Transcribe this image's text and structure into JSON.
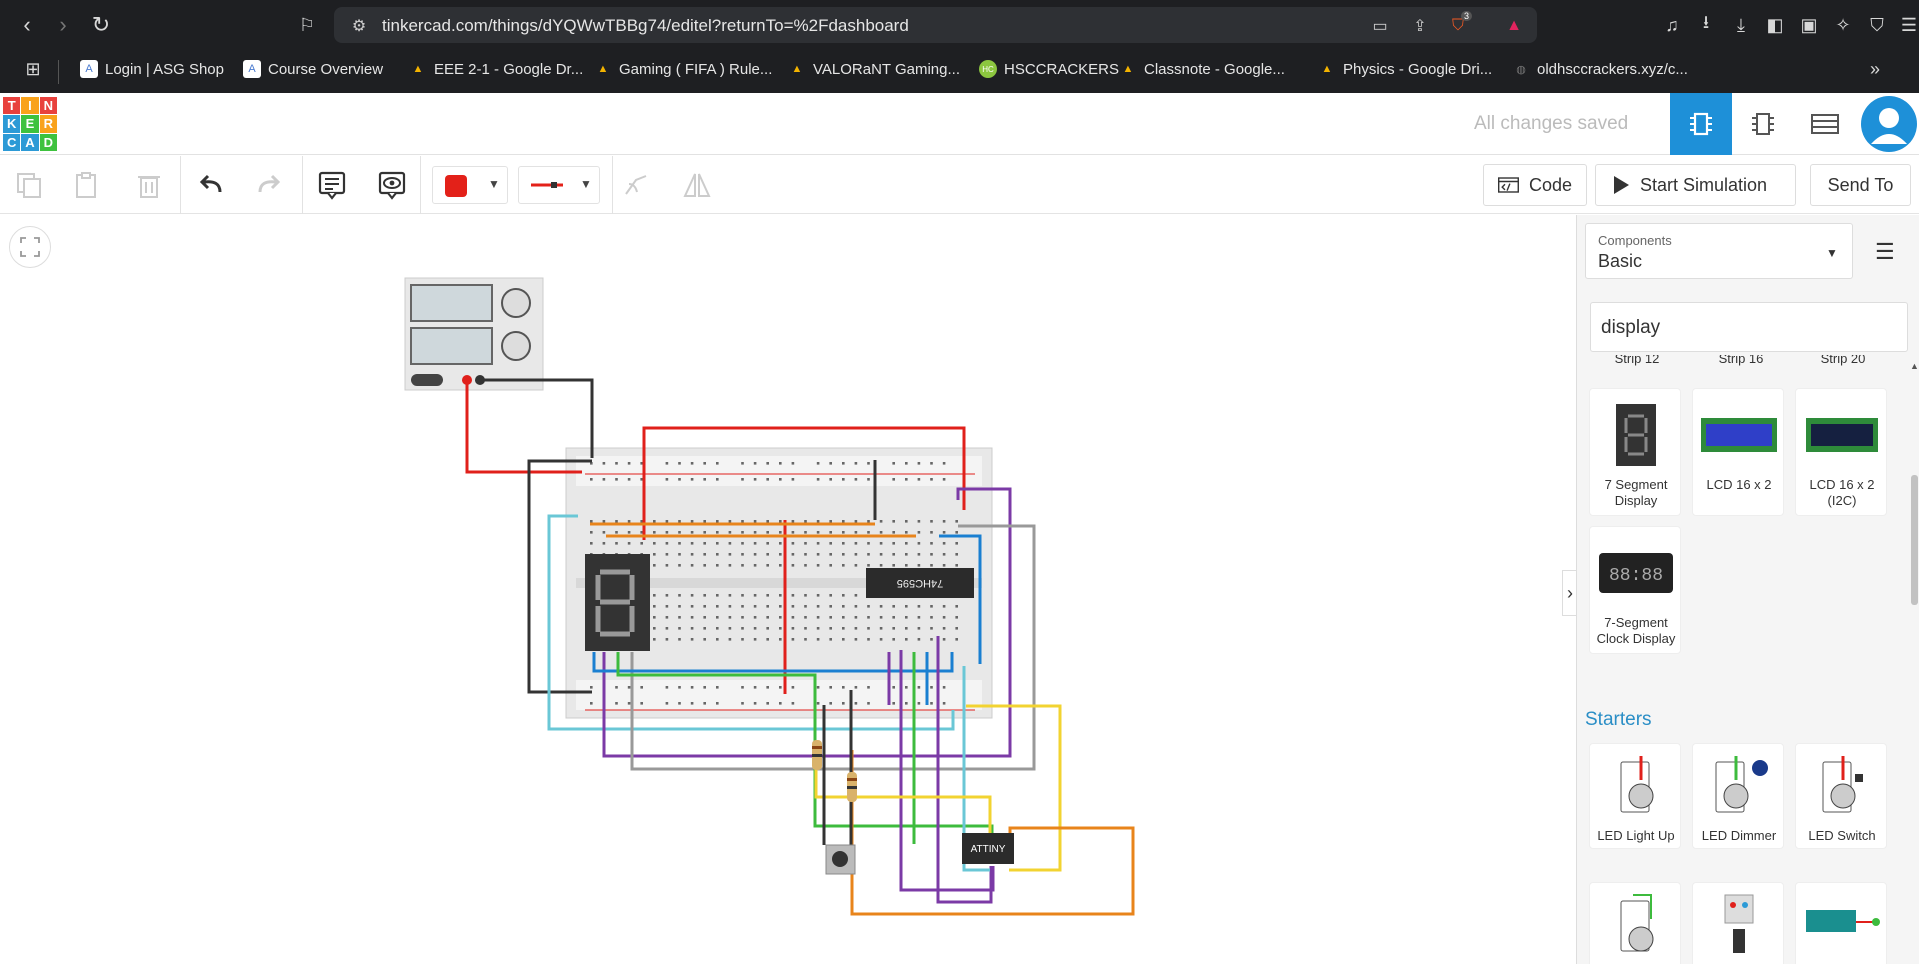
{
  "browser": {
    "url": "tinkercad.com/things/dYQWwTBBg74/editel?returnTo=%2Fdashboard",
    "brave_badge": "3"
  },
  "bookmarks": [
    {
      "label": "Login | ASG Shop",
      "color": "#4a7bd0",
      "glyph": "A"
    },
    {
      "label": "Course Overview",
      "color": "#4a7bd0",
      "glyph": "A"
    },
    {
      "label": "EEE 2-1 - Google Dr...",
      "color": "#f3b300",
      "glyph": "▲"
    },
    {
      "label": "Gaming ( FIFA ) Rule...",
      "color": "#f3b300",
      "glyph": "▲"
    },
    {
      "label": "VALORaNT Gaming...",
      "color": "#f3b300",
      "glyph": "▲"
    },
    {
      "label": "HSCCRACKERS",
      "color": "#8cc63f",
      "glyph": "HC"
    },
    {
      "label": "Classnote - Google...",
      "color": "#f3b300",
      "glyph": "▲"
    },
    {
      "label": "Physics - Google Dri...",
      "color": "#f3b300",
      "glyph": "▲"
    },
    {
      "label": "oldhsccrackers.xyz/c...",
      "color": "#777",
      "glyph": "◍"
    }
  ],
  "header": {
    "saved_status": "All changes saved",
    "logo_letters": [
      "T",
      "I",
      "N",
      "K",
      "E",
      "R",
      "C",
      "A",
      "D"
    ]
  },
  "toolbar": {
    "code_label": "Code",
    "start_sim_label": "Start Simulation",
    "send_to_label": "Send To",
    "color_swatch": "#e32119"
  },
  "panel": {
    "components_label": "Components",
    "components_value": "Basic",
    "search_value": "display",
    "partial_labels": [
      "Strip 12",
      "Strip 16",
      "Strip 20"
    ],
    "components": [
      {
        "label": "7 Segment Display",
        "icon": "seven-segment-display"
      },
      {
        "label": "LCD 16 x 2",
        "icon": "lcd"
      },
      {
        "label": "LCD 16 x 2 (I2C)",
        "icon": "lcd-i2c"
      },
      {
        "label": "7-Segment Clock Display",
        "icon": "clock-display"
      }
    ],
    "starters_title": "Starters",
    "starters": [
      {
        "label": "LED Light Up"
      },
      {
        "label": "LED Dimmer"
      },
      {
        "label": "LED Switch"
      }
    ]
  },
  "circuit": {
    "chip_label": "74HC595",
    "ic_label": "ATTINY",
    "wire_colors": {
      "red": "#e0201b",
      "black": "#333",
      "purple": "#7b3aa6",
      "gray": "#999",
      "cyan": "#6ac7d6",
      "blue": "#1a7fd1",
      "green": "#3dbb3d",
      "yellow": "#f2d331",
      "orange": "#e8841b"
    }
  }
}
